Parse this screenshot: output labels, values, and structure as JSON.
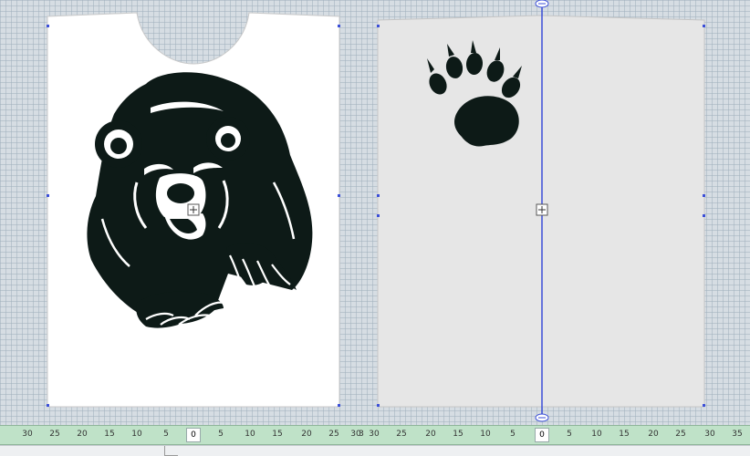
{
  "ruler": {
    "left_labels": [
      "30",
      "25",
      "20",
      "15",
      "10",
      "5",
      "0",
      "5",
      "10",
      "15",
      "20",
      "25",
      "30",
      "3"
    ],
    "right_labels": [
      "30",
      "25",
      "20",
      "15",
      "10",
      "5",
      "0",
      "5",
      "10",
      "15",
      "20",
      "25",
      "30",
      "35"
    ]
  },
  "icons": {
    "move_handle": "four-way-arrow-icon",
    "guide_handle": "double-arrow-icon",
    "bear_art": "bear-head-artwork",
    "paw_art": "bear-paw-artwork"
  },
  "colors": {
    "front_shirt": "#ffffff",
    "back_shirt": "#e6e6e6",
    "artwork": "#0d1a17",
    "guide_line": "#3b4fd8",
    "ruler_bg": "#bfe2c8"
  }
}
